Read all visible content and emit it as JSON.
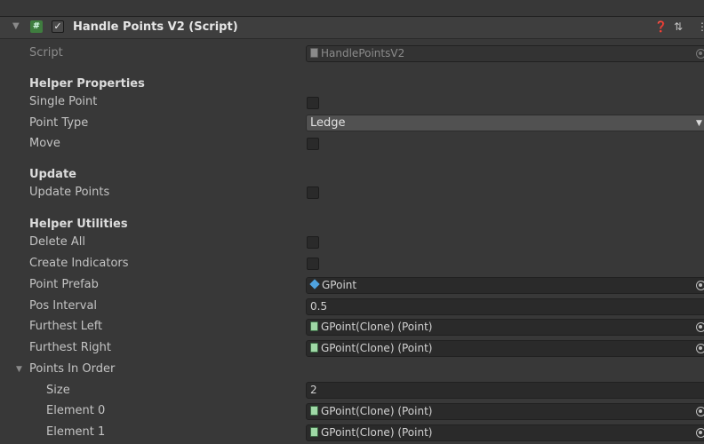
{
  "component": {
    "title": "Handle Points V2 (Script)",
    "enabled": true,
    "icons": [
      "help-icon",
      "presets-icon",
      "context-menu-icon"
    ]
  },
  "script_row": {
    "label": "Script",
    "value": "HandlePointsV2"
  },
  "sections": {
    "helper_properties": "Helper Properties",
    "update": "Update",
    "helper_utilities": "Helper Utilities"
  },
  "fields": {
    "single_point": {
      "label": "Single Point",
      "checked": false
    },
    "point_type": {
      "label": "Point Type",
      "value": "Ledge"
    },
    "move": {
      "label": "Move",
      "checked": false
    },
    "update_points": {
      "label": "Update Points",
      "checked": false
    },
    "delete_all": {
      "label": "Delete All",
      "checked": false
    },
    "create_indicators": {
      "label": "Create Indicators",
      "checked": false
    },
    "point_prefab": {
      "label": "Point Prefab",
      "value": "GPoint"
    },
    "pos_interval": {
      "label": "Pos Interval",
      "value": "0.5"
    },
    "furthest_left": {
      "label": "Furthest Left",
      "value": "GPoint(Clone) (Point)"
    },
    "furthest_right": {
      "label": "Furthest Right",
      "value": "GPoint(Clone) (Point)"
    }
  },
  "points_in_order": {
    "label": "Points In Order",
    "size_label": "Size",
    "size": "2",
    "elements": [
      {
        "label": "Element 0",
        "value": "GPoint(Clone) (Point)"
      },
      {
        "label": "Element 1",
        "value": "GPoint(Clone) (Point)"
      }
    ]
  },
  "colors": {
    "panel_bg": "#383838",
    "field_bg": "#2a2a2a",
    "script_icon": "#3f7d3f",
    "prefab_icon": "#4fa3e0"
  }
}
